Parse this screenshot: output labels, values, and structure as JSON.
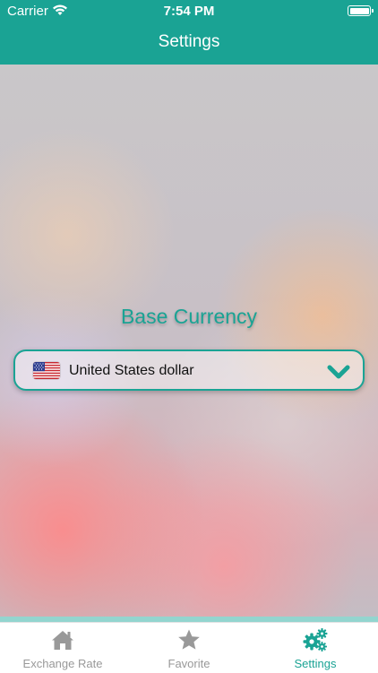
{
  "status_bar": {
    "carrier": "Carrier",
    "time": "7:54 PM"
  },
  "nav": {
    "title": "Settings"
  },
  "settings": {
    "section_label": "Base Currency",
    "selected_currency": "United States dollar",
    "flag_icon": "us-flag-icon"
  },
  "tabs": [
    {
      "label": "Exchange Rate",
      "icon": "home-icon",
      "active": false
    },
    {
      "label": "Favorite",
      "icon": "star-icon",
      "active": false
    },
    {
      "label": "Settings",
      "icon": "gears-icon",
      "active": true
    }
  ],
  "colors": {
    "accent": "#1aa394",
    "inactive_tab": "#999999"
  }
}
